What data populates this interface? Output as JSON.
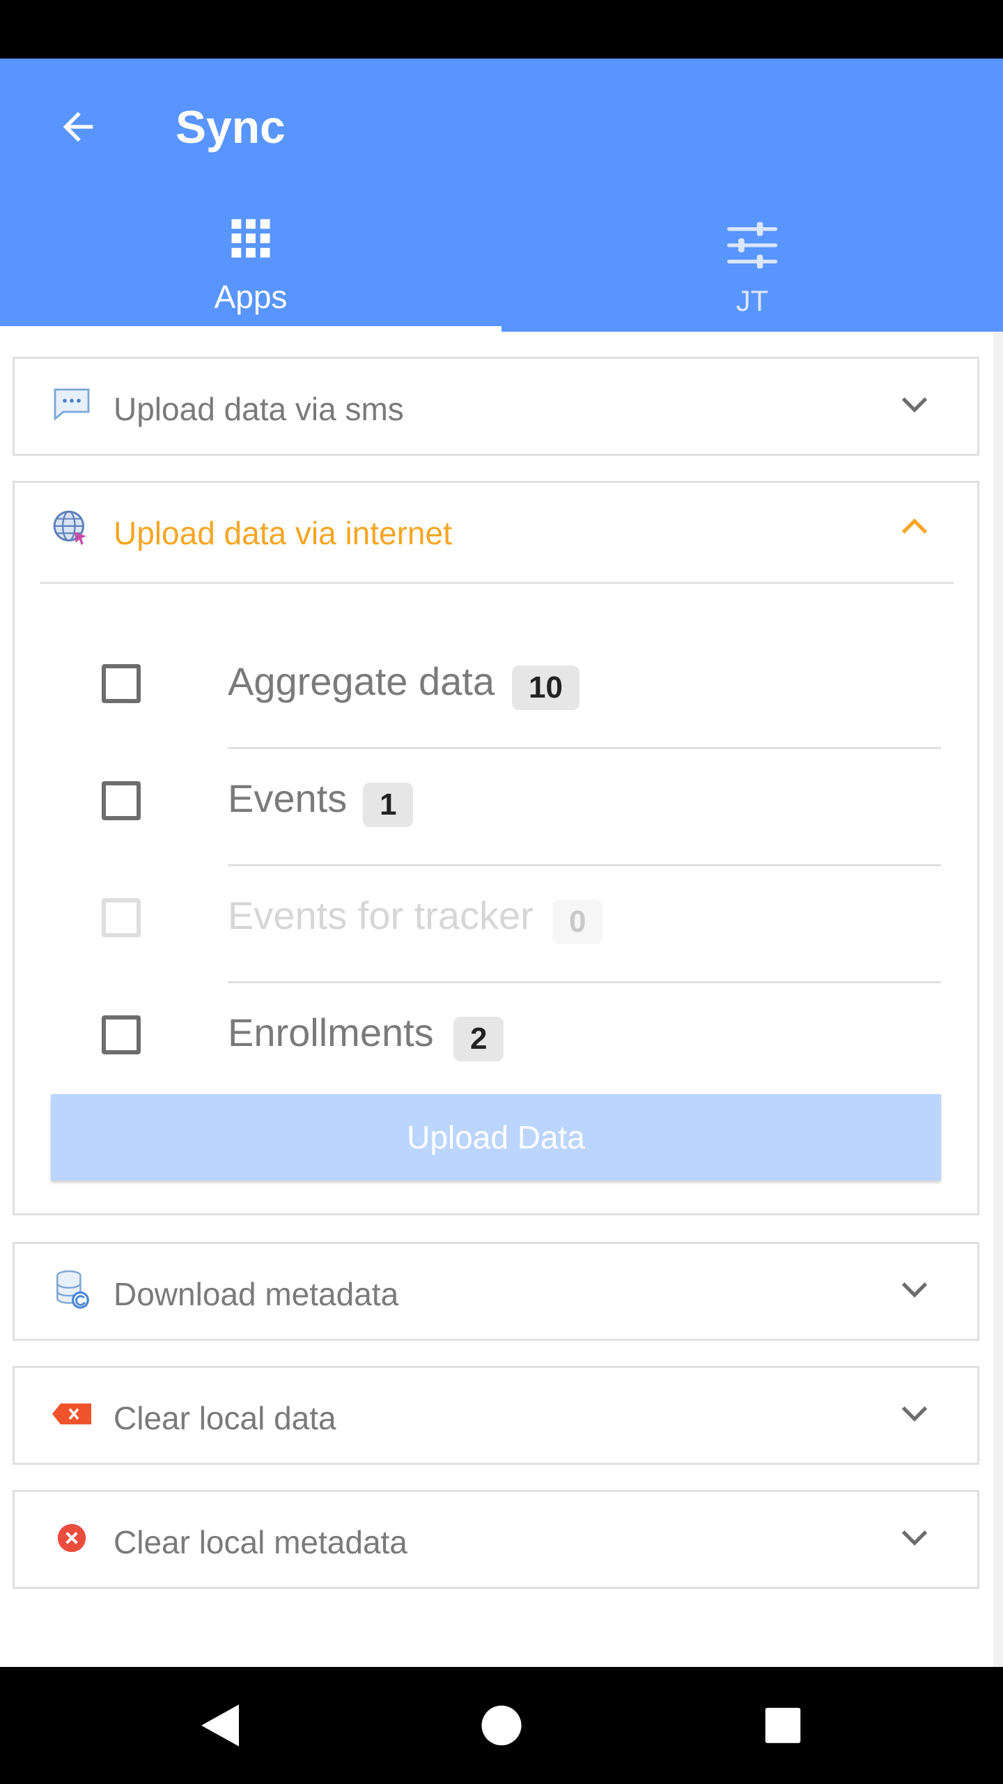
{
  "header": {
    "title": "Sync"
  },
  "tabs": [
    {
      "label": "Apps",
      "icon": "apps-grid-icon",
      "selected": true
    },
    {
      "label": "JT",
      "icon": "sliders-icon",
      "selected": false
    }
  ],
  "sections": [
    {
      "label": "Upload data via sms",
      "icon": "sms-icon",
      "expanded": false
    },
    {
      "label": "Upload data via internet",
      "icon": "globe-icon",
      "expanded": true,
      "items": [
        {
          "label": "Aggregate data",
          "count": "10",
          "enabled": true,
          "checked": false
        },
        {
          "label": "Events",
          "count": "1",
          "enabled": true,
          "checked": false
        },
        {
          "label": "Events for tracker",
          "count": "0",
          "enabled": false,
          "checked": false
        },
        {
          "label": "Enrollments",
          "count": "2",
          "enabled": true,
          "checked": false
        }
      ],
      "button_label": "Upload Data"
    },
    {
      "label": "Download metadata",
      "icon": "database-sync-icon",
      "expanded": false
    },
    {
      "label": "Clear local data",
      "icon": "backspace-icon",
      "expanded": false
    },
    {
      "label": "Clear local metadata",
      "icon": "cancel-circle-icon",
      "expanded": false
    }
  ],
  "colors": {
    "app_bar": "#5995fe",
    "active_section": "#f5a623",
    "upload_button_disabled": "#bcd5fd"
  }
}
